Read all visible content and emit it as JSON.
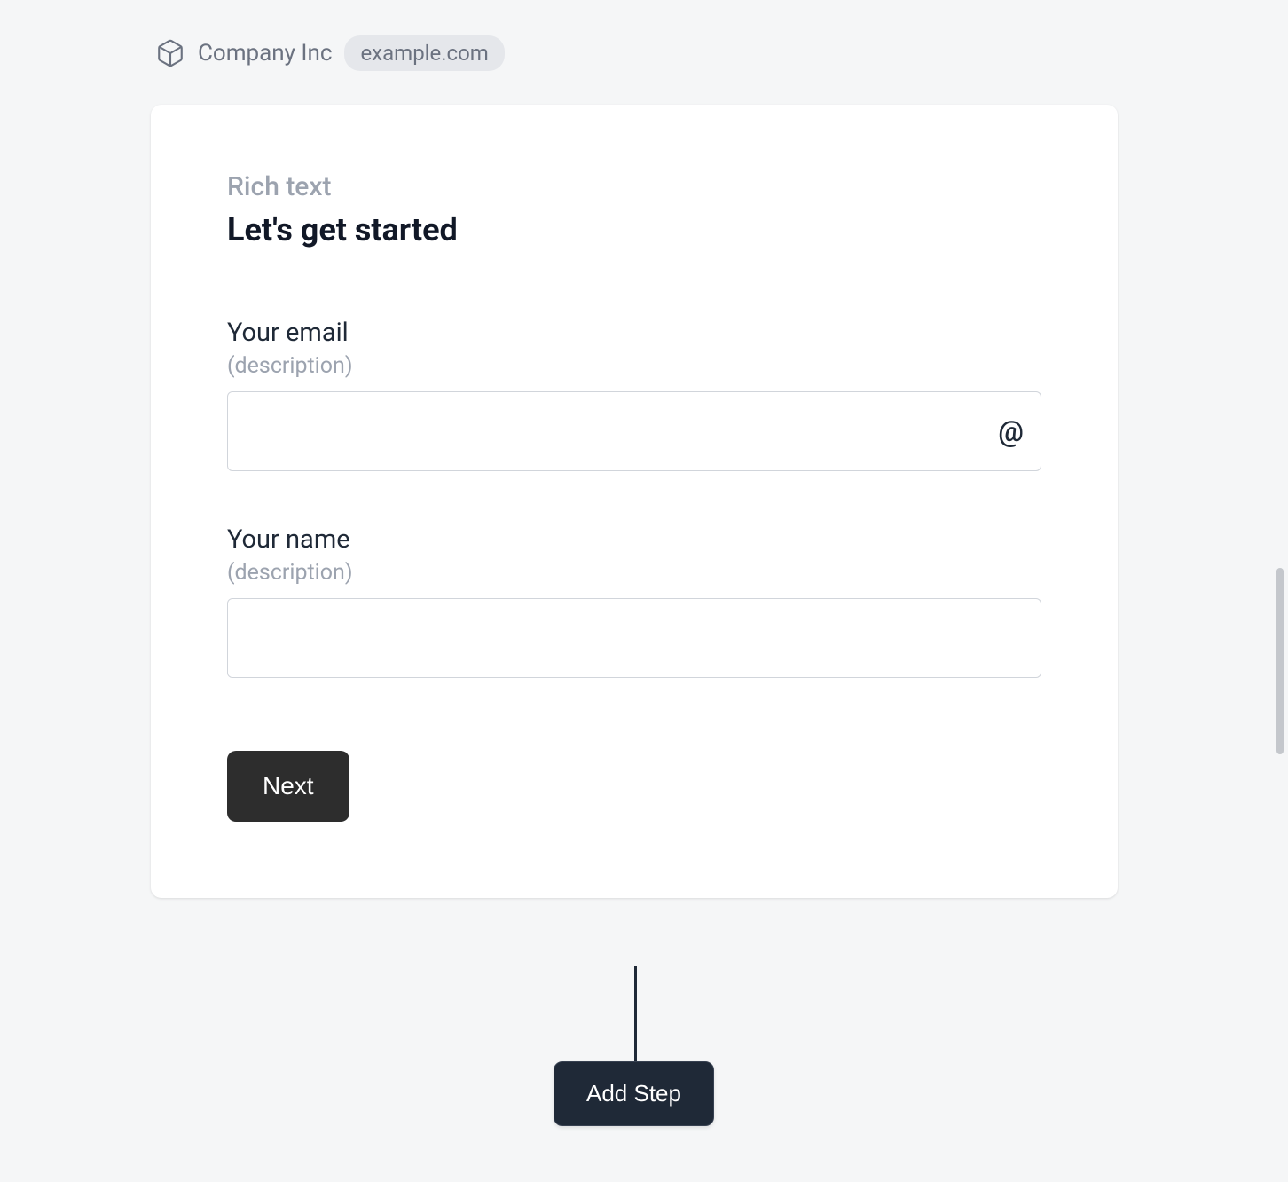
{
  "header": {
    "company_name": "Company Inc",
    "domain": "example.com"
  },
  "card": {
    "section_label": "Rich text",
    "heading": "Let's get started",
    "email_field": {
      "label": "Your email",
      "description": "(description)",
      "value": ""
    },
    "name_field": {
      "label": "Your name",
      "description": "(description)",
      "value": ""
    },
    "next_button_label": "Next"
  },
  "add_step_label": "Add Step"
}
